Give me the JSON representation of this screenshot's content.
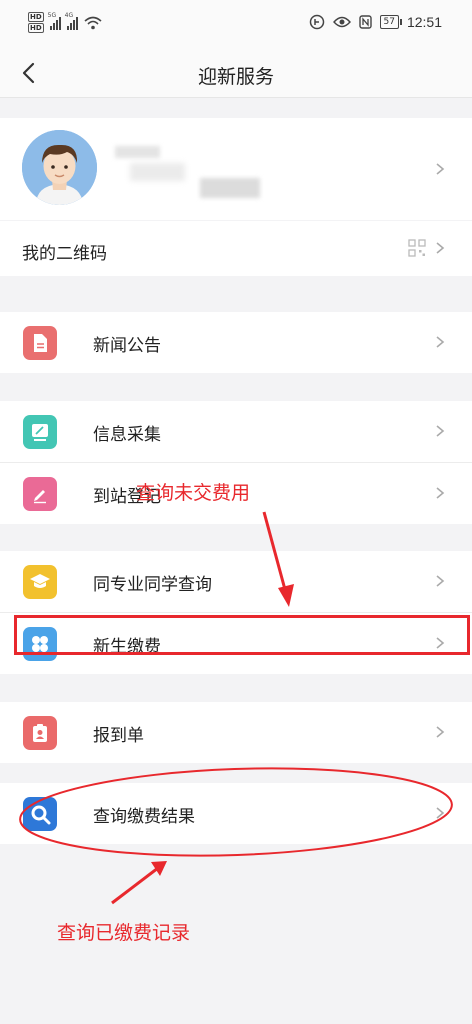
{
  "status_bar": {
    "hd": [
      "HD",
      "HD"
    ],
    "net1": "5G",
    "net2": "4G",
    "battery": "57",
    "time": "12:51"
  },
  "nav": {
    "title": "迎新服务"
  },
  "profile": {
    "qr_label": "我的二维码"
  },
  "menu": {
    "news": "新闻公告",
    "info_collect": "信息采集",
    "arrival_register": "到站登记",
    "classmate_query": "同专业同学查询",
    "new_student_payment": "新生缴费",
    "report_form": "报到单",
    "payment_result": "查询缴费结果"
  },
  "annotations": {
    "query_unpaid": "查询未交费用",
    "query_paid": "查询已缴费记录"
  },
  "colors": {
    "news_icon": "#e96f6f",
    "info_icon": "#43c6b4",
    "arrival_icon": "#ea6a96",
    "classmate_icon": "#f2c12e",
    "payment_icon": "#4aa3e8",
    "report_icon": "#ea6a6a",
    "result_icon": "#2e78d8",
    "annotation": "#e8282d"
  }
}
